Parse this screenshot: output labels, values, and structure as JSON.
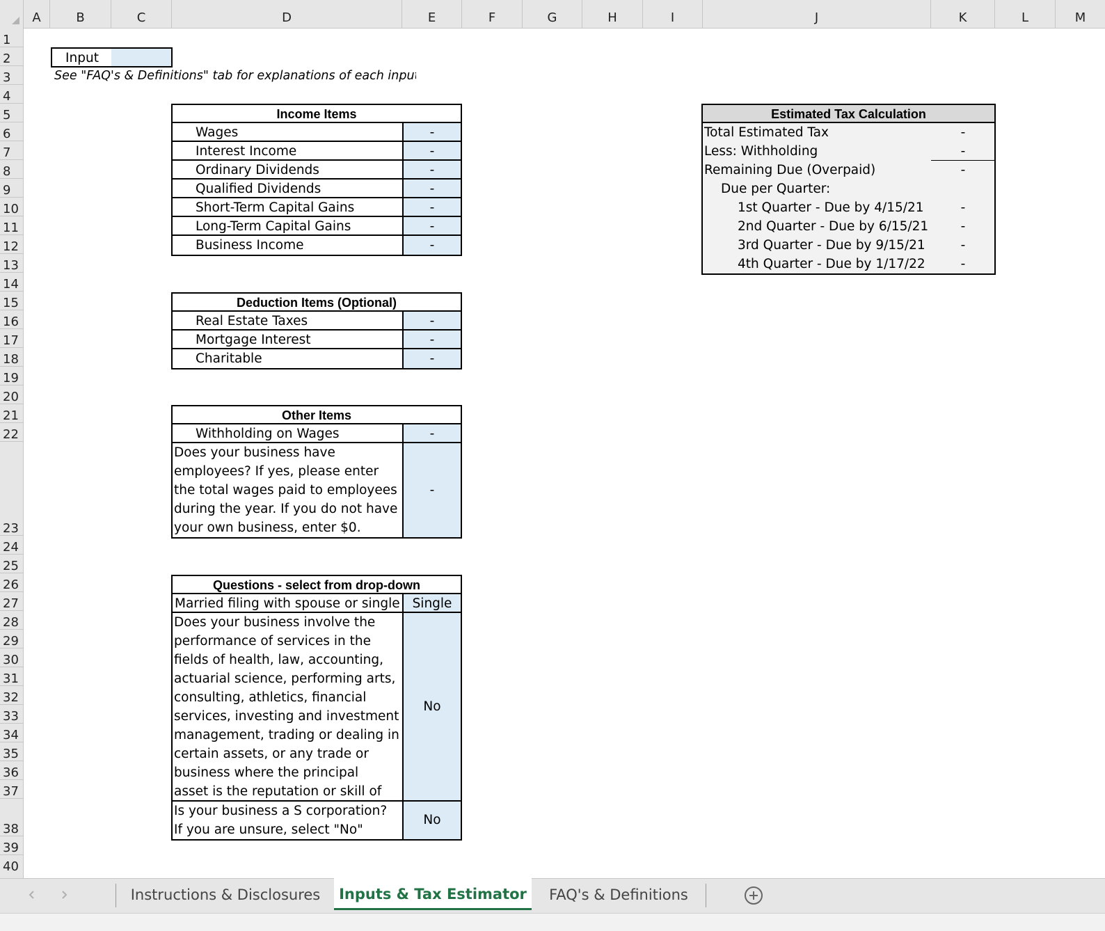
{
  "columns": [
    "A",
    "B",
    "C",
    "D",
    "E",
    "F",
    "G",
    "H",
    "I",
    "J",
    "K",
    "L",
    "M"
  ],
  "rows": [
    "1",
    "2",
    "3",
    "4",
    "5",
    "6",
    "7",
    "8",
    "9",
    "10",
    "11",
    "12",
    "13",
    "14",
    "15",
    "16",
    "17",
    "18",
    "19",
    "20",
    "21",
    "22",
    "23",
    "24",
    "25",
    "26",
    "27",
    "28",
    "29",
    "30",
    "31",
    "32",
    "33",
    "34",
    "35",
    "36",
    "37",
    "38",
    "39",
    "40"
  ],
  "legend": {
    "input_label": "Input",
    "note": "See \"FAQ's & Definitions\" tab for explanations of each input"
  },
  "income": {
    "title": "Income Items",
    "items": [
      {
        "label": "Wages",
        "value": "-"
      },
      {
        "label": "Interest Income",
        "value": "-"
      },
      {
        "label": "Ordinary Dividends",
        "value": "-"
      },
      {
        "label": "Qualified Dividends",
        "value": "-"
      },
      {
        "label": "Short-Term Capital Gains",
        "value": "-"
      },
      {
        "label": "Long-Term Capital Gains",
        "value": "-"
      },
      {
        "label": "Business Income",
        "value": "-"
      }
    ]
  },
  "deduction": {
    "title": "Deduction Items (Optional)",
    "items": [
      {
        "label": "Real Estate Taxes",
        "value": "-"
      },
      {
        "label": "Mortgage Interest",
        "value": "-"
      },
      {
        "label": "Charitable",
        "value": "-"
      }
    ]
  },
  "other": {
    "title": "Other Items",
    "withholding_label": "Withholding on Wages",
    "withholding_value": "-",
    "employees_lines": [
      "Does your business have",
      "employees? If yes, please enter",
      "the total wages paid to employees",
      "during the year. If you do not have",
      "your own business, enter $0."
    ],
    "employees_value": "-"
  },
  "questions": {
    "title": "Questions - select from drop-down",
    "married_label": "Married filing with spouse or single",
    "married_value": "Single",
    "services_lines": [
      "Does your business involve the",
      "performance of services in the",
      "fields of health, law, accounting,",
      "actuarial science, performing arts,",
      "consulting, athletics, financial",
      "services, investing and investment",
      "management, trading or dealing in",
      "certain assets, or any trade or",
      "business where the principal",
      "asset is the reputation or skill of"
    ],
    "services_value": "No",
    "scorp_lines": [
      "Is your business a S corporation?",
      "If you are unsure, select \"No\""
    ],
    "scorp_value": "No"
  },
  "estimate": {
    "title": "Estimated Tax Calculation",
    "rows": [
      {
        "label": "Total Estimated Tax",
        "value": "-"
      },
      {
        "label": "Less: Withholding",
        "value": "-"
      },
      {
        "label": "Remaining Due (Overpaid)",
        "value": "-"
      },
      {
        "label": "Due per Quarter:",
        "value": ""
      },
      {
        "label": "1st Quarter -  Due by 4/15/21",
        "value": "-"
      },
      {
        "label": "2nd Quarter - Due by 6/15/21",
        "value": "-"
      },
      {
        "label": "3rd Quarter -  Due by 9/15/21",
        "value": "-"
      },
      {
        "label": "4th Quarter -  Due by 1/17/22",
        "value": "-"
      }
    ]
  },
  "tabs": [
    {
      "label": "Instructions & Disclosures"
    },
    {
      "label": "Inputs & Tax Estimator"
    },
    {
      "label": "FAQ's & Definitions"
    }
  ],
  "active_tab_color": "#217346",
  "input_fill": "#ddebf7",
  "calc_fill": "#f2f2f2",
  "icons": {
    "prev": "chevron-left-icon",
    "next": "chevron-right-icon",
    "add": "plus-circle-icon"
  }
}
